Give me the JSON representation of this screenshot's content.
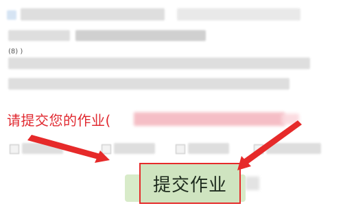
{
  "homework": {
    "prompt": "请提交您的作业(",
    "prompt_suffix_blurred": "",
    "submit_label": "提交作业",
    "options_row_count": 4
  },
  "icons": {
    "top_left_icon": "image-icon",
    "arrow_left": "red-arrow-icon",
    "arrow_right": "red-arrow-icon"
  },
  "colors": {
    "prompt_red": "#e0282f",
    "arrow_red": "#e62a2a",
    "button_green": "#cfe4c0"
  },
  "misc": {
    "small_glyph": "(8) )"
  }
}
